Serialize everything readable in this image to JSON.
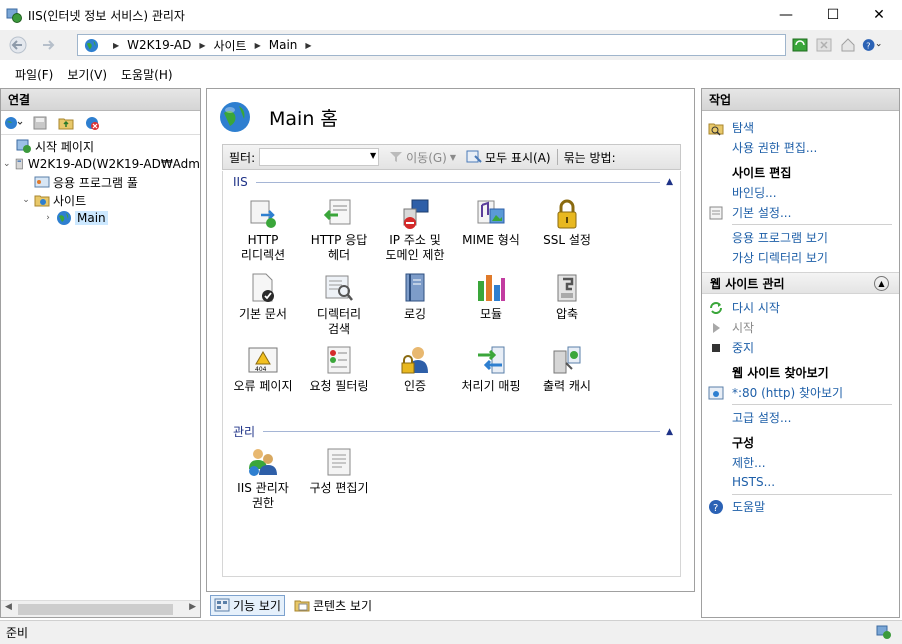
{
  "window": {
    "title": "IIS(인터넷 정보 서비스) 관리자",
    "minimize": "—",
    "maximize": "☐",
    "close": "✕"
  },
  "address": {
    "crumbs": [
      "W2K19-AD",
      "사이트",
      "Main"
    ]
  },
  "menu": [
    "파일(F)",
    "보기(V)",
    "도움말(H)"
  ],
  "connections": {
    "title": "연결",
    "tree": {
      "start_page": "시작 페이지",
      "server": "W2K19-AD(W2K19-AD₩Adm",
      "app_pools": "응용 프로그램 풀",
      "sites": "사이트",
      "main": "Main"
    }
  },
  "center": {
    "title": "Main 홈",
    "filter_label": "필터:",
    "filter_value": "",
    "go_label": "이동(G)",
    "show_all_label": "모두 표시(A)",
    "group_by_label": "묶는 방법:",
    "groups": {
      "iis": "IIS",
      "management": "관리"
    },
    "features_iis": [
      {
        "label": "HTTP\n리디렉션",
        "icon": "http-redirect-icon"
      },
      {
        "label": "HTTP 응답\n헤더",
        "icon": "http-response-headers-icon"
      },
      {
        "label": "IP 주소 및\n도메인 제한",
        "icon": "ip-domain-restriction-icon"
      },
      {
        "label": "MIME 형식",
        "icon": "mime-types-icon"
      },
      {
        "label": "SSL 설정",
        "icon": "ssl-settings-icon"
      },
      {
        "label": "기본 문서",
        "icon": "default-document-icon"
      },
      {
        "label": "디렉터리\n검색",
        "icon": "directory-browsing-icon"
      },
      {
        "label": "로깅",
        "icon": "logging-icon"
      },
      {
        "label": "모듈",
        "icon": "modules-icon"
      },
      {
        "label": "압축",
        "icon": "compression-icon"
      },
      {
        "label": "오류 페이지",
        "icon": "error-pages-icon"
      },
      {
        "label": "요청 필터링",
        "icon": "request-filtering-icon"
      },
      {
        "label": "인증",
        "icon": "authentication-icon"
      },
      {
        "label": "처리기 매핑",
        "icon": "handler-mappings-icon"
      },
      {
        "label": "출력 캐시",
        "icon": "output-caching-icon"
      }
    ],
    "features_management": [
      {
        "label": "IIS 관리자\n권한",
        "icon": "iis-manager-permissions-icon"
      },
      {
        "label": "구성 편집기",
        "icon": "configuration-editor-icon"
      }
    ],
    "view_tabs": {
      "features": "기능 보기",
      "content": "콘텐츠 보기"
    }
  },
  "actions": {
    "title": "작업",
    "explore": "탐색",
    "edit_permissions": "사용 권한 편집...",
    "edit_site_title": "사이트 편집",
    "bindings": "바인딩...",
    "basic_settings": "기본 설정...",
    "view_applications": "응용 프로그램 보기",
    "view_virtual_dirs": "가상 디렉터리 보기",
    "manage_site_title": "웹 사이트 관리",
    "restart": "다시 시작",
    "start": "시작",
    "stop": "중지",
    "browse_site_title": "웹 사이트 찾아보기",
    "browse_80": "*:80 (http) 찾아보기",
    "advanced_settings": "고급 설정...",
    "configure_title": "구성",
    "limits": "제한...",
    "hsts": "HSTS...",
    "help": "도움말"
  },
  "status": {
    "text": "준비"
  }
}
